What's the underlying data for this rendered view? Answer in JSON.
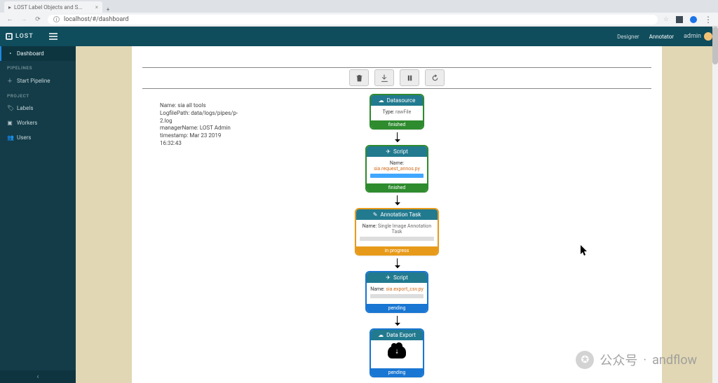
{
  "browser": {
    "tab_title": "LOST Label Objects and S...",
    "url": "localhost/#/dashboard"
  },
  "topnav": {
    "brand": "LOST",
    "links": {
      "designer": "Designer",
      "annotator": "Annotator",
      "user": "admin"
    }
  },
  "sidebar": {
    "dashboard": "Dashboard",
    "heads": {
      "pipelines": "PIPELINES",
      "project": "PROJECT"
    },
    "items": {
      "start_pipeline": "Start Pipeline",
      "labels": "Labels",
      "workers": "Workers",
      "users": "Users"
    }
  },
  "meta": {
    "name_label": "Name:",
    "name_value": "sia all tools",
    "log_label": "LogfilePath:",
    "log_value": "data/logs/pipes/p-2.log",
    "mgr_label": "managerName:",
    "mgr_value": "LOST Admin",
    "ts_label": "timestamp:",
    "ts_value": "Mar 23 2019 16:32:43"
  },
  "flow": {
    "type_label": "Type:",
    "name_label": "Name:",
    "n0": {
      "title": "Datasource",
      "type": "rawFile",
      "status": "finished"
    },
    "n1": {
      "title": "Script",
      "name": "sia.request_annos.py",
      "status": "finished"
    },
    "n2": {
      "title": "Annotation Task",
      "name": "Single Image Annotation Task",
      "status": "in progress"
    },
    "n3": {
      "title": "Script",
      "name": "sia.export_csv.py",
      "status": "pending"
    },
    "n4": {
      "title": "Data Export",
      "status": "pending"
    }
  },
  "watermark": {
    "gzh": "公众号",
    "name": "andflow"
  }
}
